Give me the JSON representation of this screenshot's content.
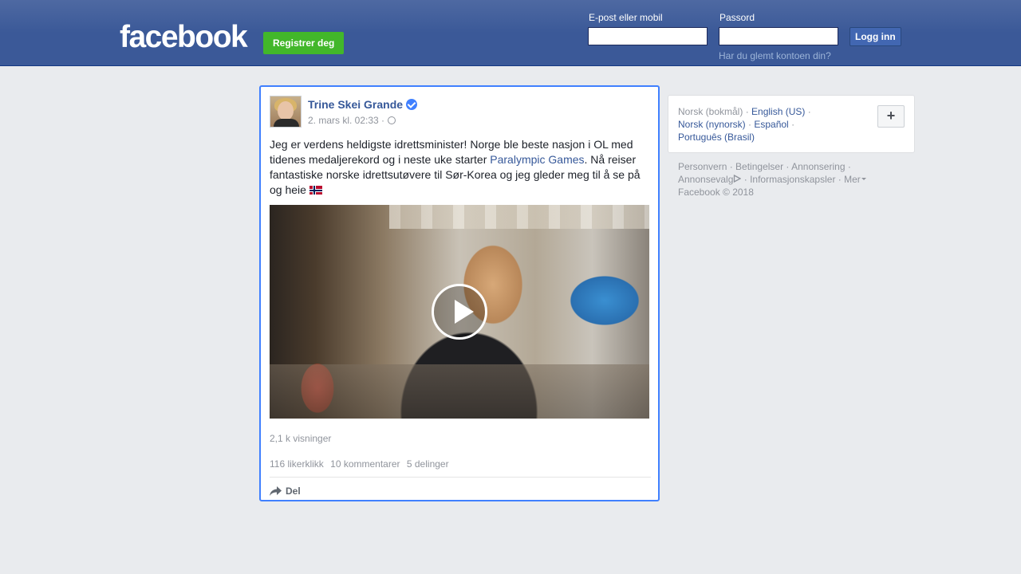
{
  "header": {
    "logo": "facebook",
    "register_label": "Registrer deg",
    "email_label": "E-post eller mobil",
    "password_label": "Passord",
    "login_label": "Logg inn",
    "forgot_label": "Har du glemt kontoen din?",
    "email_value": "",
    "password_value": ""
  },
  "post": {
    "author": "Trine Skei Grande",
    "timestamp": "2. mars kl. 02:33 ·",
    "text_part1": "Jeg er verdens heldigste idrettsminister! Norge ble beste nasjon i OL med tidenes medaljerekord og i neste uke starter ",
    "link_text": "Paralympic Games",
    "text_part2": ". Nå reiser fantastiske norske idrettsutøvere til Sør-Korea og jeg gleder meg til å se på og heie ",
    "views": "2,1 k visninger",
    "likes": "116 likerklikk",
    "comments": "10 kommentarer",
    "shares": "5 delinger",
    "share_label": "Del"
  },
  "sidebar": {
    "languages": {
      "current": "Norsk (bokmål)",
      "english": "English (US)",
      "nynorsk": "Norsk (nynorsk)",
      "espanol": "Español",
      "portugues": "Português (Brasil)",
      "separator": " · ",
      "add_button": "+"
    },
    "footer": {
      "privacy": "Personvern",
      "terms": "Betingelser",
      "advertising": "Annonsering",
      "adchoices": "Annonsevalg",
      "cookies": "Informasjonskapsler",
      "more": "Mer",
      "separator": " · ",
      "copyright": "Facebook © 2018"
    }
  },
  "colors": {
    "header_blue": "#3b5998",
    "link_blue": "#365899",
    "register_green": "#42b72a",
    "focus_border": "#4080ff",
    "page_bg": "#e9ebee"
  }
}
